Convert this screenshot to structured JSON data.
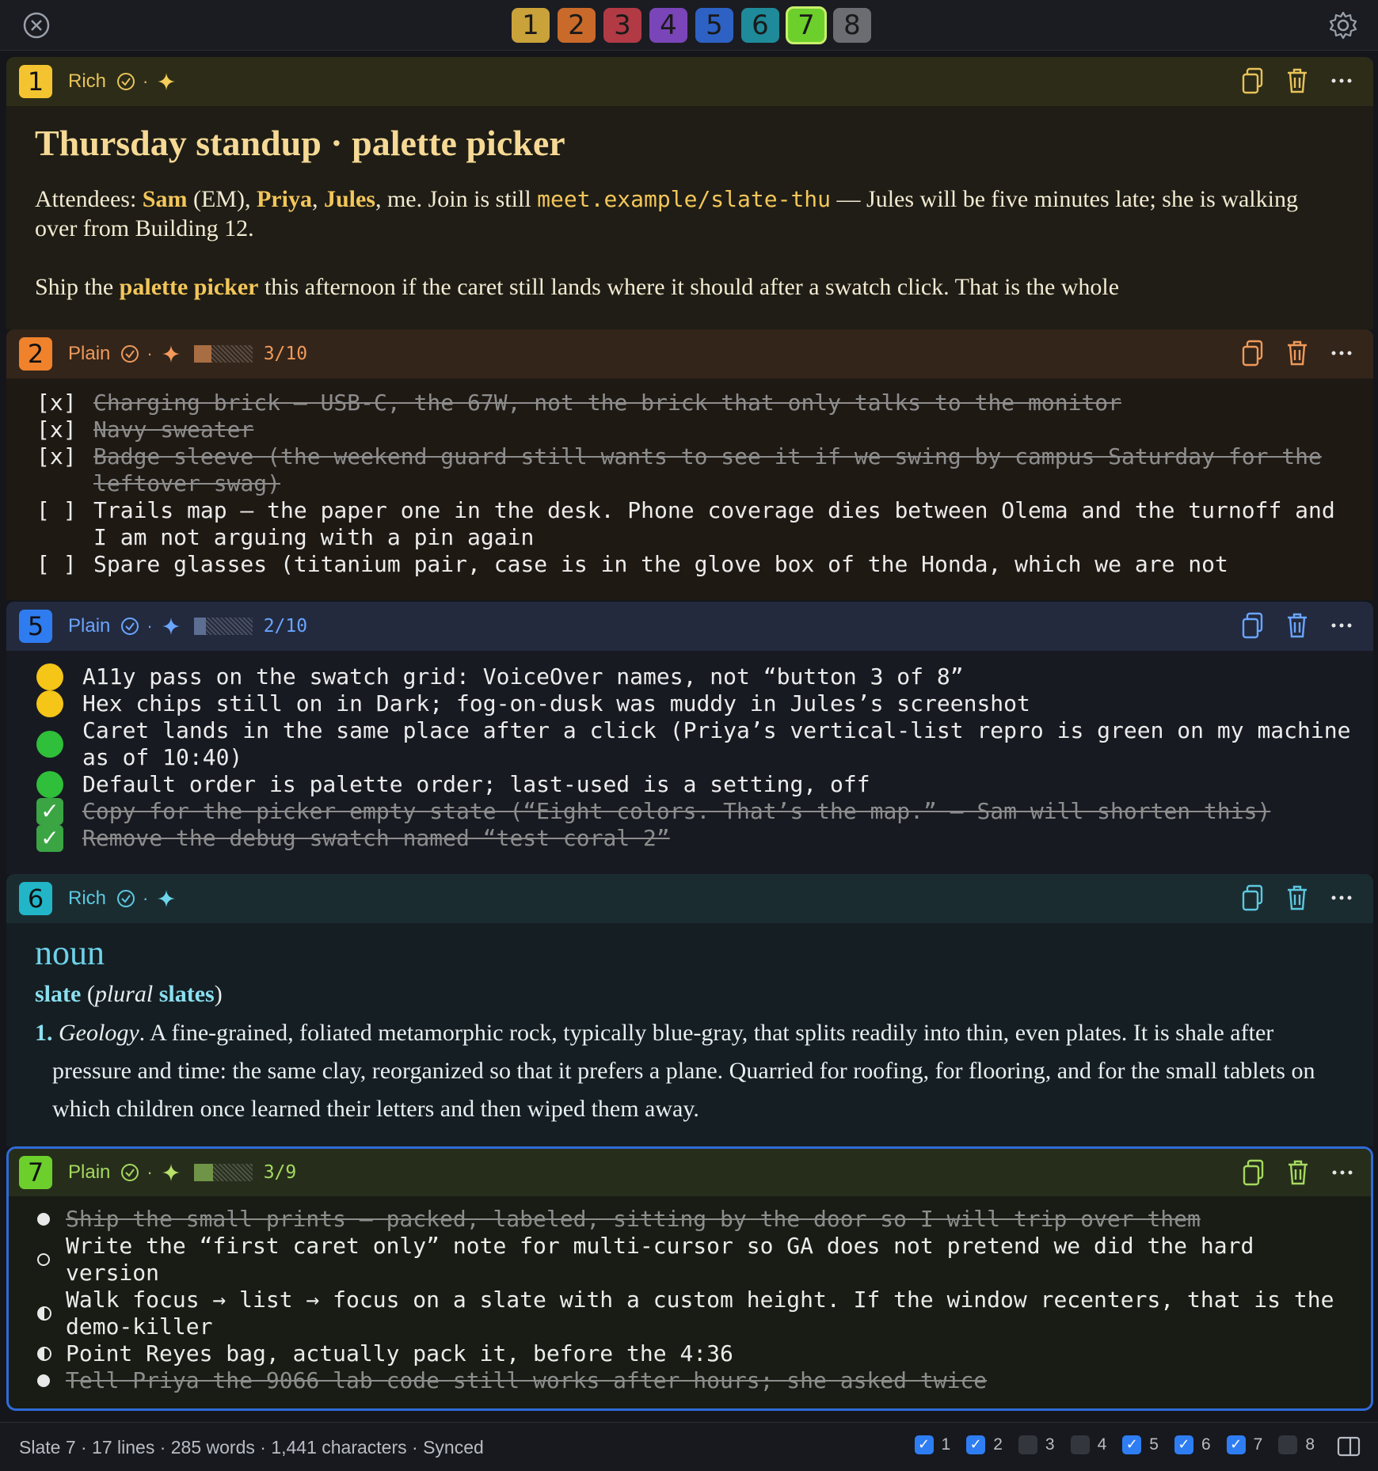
{
  "tabs": [
    {
      "label": "1",
      "color": "#c9a23a"
    },
    {
      "label": "2",
      "color": "#c96a2a"
    },
    {
      "label": "3",
      "color": "#b23a45"
    },
    {
      "label": "4",
      "color": "#7a45b8"
    },
    {
      "label": "5",
      "color": "#2d62c4"
    },
    {
      "label": "6",
      "color": "#1f8a99"
    },
    {
      "label": "7",
      "color": "#6ccf2c",
      "active": true
    },
    {
      "label": "8",
      "color": "#6b6d73"
    }
  ],
  "slate1": {
    "num": "1",
    "mode": "Rich",
    "sep": "·",
    "accent": "#f4c430",
    "title": "Thursday standup · palette picker",
    "p1": {
      "a": "Attendees: ",
      "sam": "Sam",
      "b": " (EM), ",
      "priya": "Priya",
      "c": ", ",
      "jules": "Jules",
      "d": ", me. Join is still ",
      "link": "meet.example/slate-thu",
      "e": " — Jules will be five minutes late; she is walking over from Building 12."
    },
    "p2": {
      "a": "Ship the ",
      "bold": "palette picker",
      "b": " this afternoon if the caret still lands where it should after a swatch click. That is the whole"
    }
  },
  "slate2": {
    "num": "2",
    "mode": "Plain",
    "sep": "·",
    "count": "3/10",
    "progress": 0.3,
    "accent": "#f0822c",
    "items": [
      {
        "mark": "[x]",
        "text": "Charging brick — USB-C, the 67W, not the brick that only talks to the monitor",
        "done": true
      },
      {
        "mark": "[x]",
        "text": "Navy sweater",
        "done": true
      },
      {
        "mark": "[x]",
        "text": "Badge sleeve (the weekend guard still wants to see it if we swing by campus Saturday for the leftover swag)",
        "done": true
      },
      {
        "mark": "[ ]",
        "text": "Trails map — the paper one in the desk. Phone coverage dies between Olema and the turnoff and I am not arguing with a pin again",
        "done": false
      },
      {
        "mark": "[ ]",
        "text": "Spare glasses (titanium pair, case is in the glove box of the Honda, which we are not",
        "done": false
      }
    ]
  },
  "slate5": {
    "num": "5",
    "mode": "Plain",
    "sep": "·",
    "count": "2/10",
    "progress": 0.2,
    "accent": "#2f7cf0",
    "items": [
      {
        "status": "yellow",
        "text": "A11y pass on the swatch grid: VoiceOver names, not “button 3 of 8”"
      },
      {
        "status": "yellow",
        "text": "Hex chips still on in Dark; fog-on-dusk was muddy in Jules’s screenshot"
      },
      {
        "status": "green",
        "text": "Caret lands in the same place after a click (Priya’s vertical-list repro is green on my machine as of 10:40)"
      },
      {
        "status": "green",
        "text": "Default order is palette order; last-used is a setting, off"
      },
      {
        "status": "check",
        "text": "Copy for the picker empty state (“Eight colors. That’s the map.” — Sam will shorten this)"
      },
      {
        "status": "check",
        "text": "Remove the debug swatch named “test coral 2”"
      }
    ]
  },
  "slate6": {
    "num": "6",
    "mode": "Rich",
    "sep": "·",
    "accent": "#22b5c8",
    "pos": "noun",
    "head": {
      "word": "slate",
      "open": " (",
      "plural": "plural",
      "space": " ",
      "pword": "slates",
      "close": ")"
    },
    "def": {
      "num": "1.",
      "field": "Geology",
      "text": ". A fine-grained, foliated metamorphic rock, typically blue-gray, that splits readily into thin, even plates. It is shale after pressure and time: the same clay, reorganized so that it prefers a plane. Quarried for roofing, for flooring, and for the small tablets on which children once learned their letters and then wiped them away."
    }
  },
  "slate7": {
    "num": "7",
    "mode": "Plain",
    "sep": "·",
    "count": "3/9",
    "progress": 0.33,
    "accent": "#6ccf2c",
    "items": [
      {
        "bullet": "full",
        "text": "Ship the small prints — packed, labeled, sitting by the door so I will trip over them",
        "done": true
      },
      {
        "bullet": "empty",
        "text": "Write the “first caret only” note for multi-cursor so GA does not pretend we did the hard version",
        "done": false
      },
      {
        "bullet": "half",
        "text": "Walk focus → list → focus on a slate with a custom height. If the window recenters, that is the demo-killer",
        "done": false
      },
      {
        "bullet": "half",
        "text": "Point Reyes bag, actually pack it, before the 4:36",
        "done": false
      },
      {
        "bullet": "full",
        "text": "Tell Priya the 9066 lab code still works after hours; she asked twice",
        "done": true
      }
    ]
  },
  "footer": {
    "stats": "Slate 7 · 17 lines · 285 words · 1,441 characters · Synced",
    "toggles": [
      {
        "label": "1",
        "on": true
      },
      {
        "label": "2",
        "on": true
      },
      {
        "label": "3",
        "on": false
      },
      {
        "label": "4",
        "on": false
      },
      {
        "label": "5",
        "on": true
      },
      {
        "label": "6",
        "on": true
      },
      {
        "label": "7",
        "on": true
      },
      {
        "label": "8",
        "on": false
      }
    ]
  },
  "icons": [
    "close-icon",
    "gear-icon",
    "check-circle-icon",
    "sparkle-icon",
    "copy-icon",
    "trash-icon",
    "more-icon",
    "split-view-icon"
  ]
}
